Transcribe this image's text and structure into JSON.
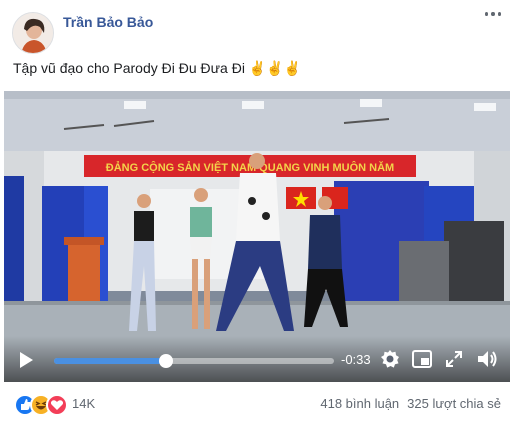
{
  "post": {
    "author": "Trần Bảo Bảo",
    "caption": "Tập vũ đạo cho Parody Đi Đu Đưa Đi ✌✌✌"
  },
  "video": {
    "banner_text": "ĐẢNG CỘNG SẢN VIỆT NAM QUANG VINH MUÔN NĂM",
    "progress_fraction": 0.4,
    "time_remaining": "-0:33",
    "controls": {
      "play_icon": "play-icon",
      "settings_icon": "gear-icon",
      "pip_icon": "picture-in-picture-icon",
      "fullscreen_icon": "fullscreen-icon",
      "volume_icon": "volume-icon"
    }
  },
  "footer": {
    "reaction_icons": [
      "like-icon",
      "haha-icon",
      "love-icon"
    ],
    "reaction_count": "14K",
    "comments": "418 bình luận",
    "shares": "325 lượt chia sẻ"
  },
  "colors": {
    "author": "#385898",
    "progress": "#4a90e2",
    "like": "#1877f2",
    "haha": "#f7b125",
    "love": "#f33e58"
  }
}
